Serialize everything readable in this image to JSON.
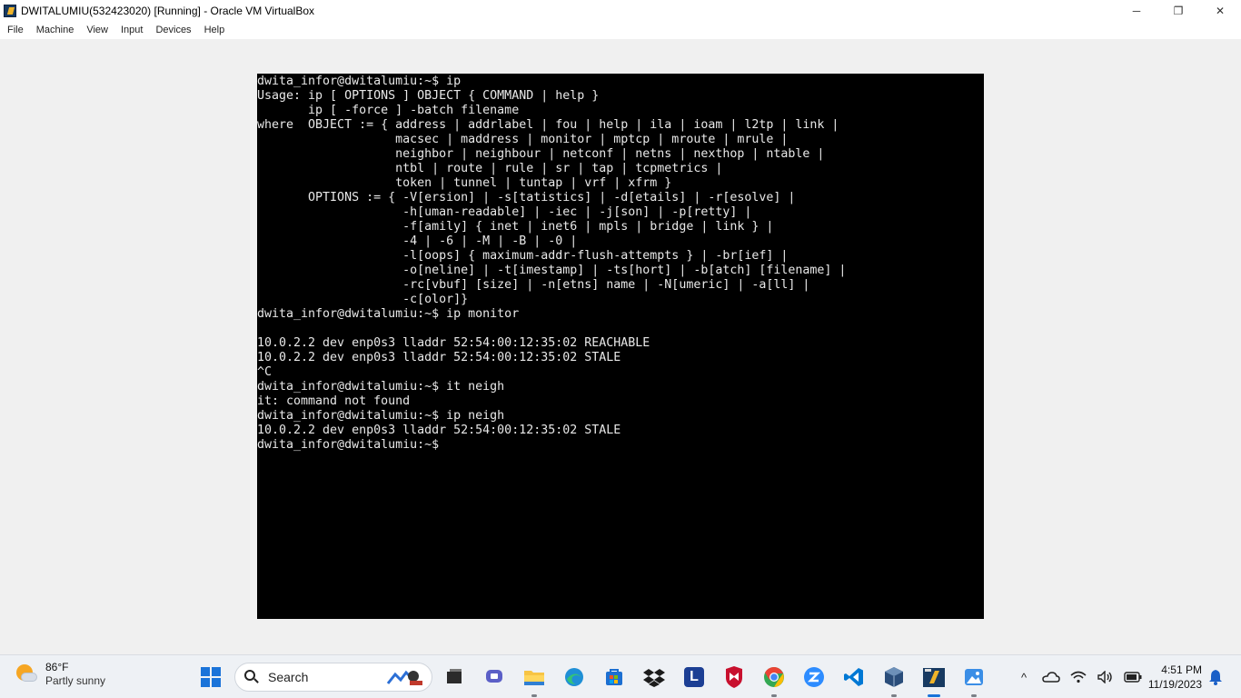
{
  "window": {
    "title": "DWITALUMIU(532423020) [Running] - Oracle VM VirtualBox",
    "icon": "virtualbox-icon",
    "controls": {
      "minimize": "─",
      "restore": "❐",
      "close": "✕"
    }
  },
  "menu": {
    "items": [
      "File",
      "Machine",
      "View",
      "Input",
      "Devices",
      "Help"
    ]
  },
  "terminal": {
    "lines": [
      "dwita_infor@dwitalumiu:~$ ip",
      "Usage: ip [ OPTIONS ] OBJECT { COMMAND | help }",
      "       ip [ -force ] -batch filename",
      "where  OBJECT := { address | addrlabel | fou | help | ila | ioam | l2tp | link |",
      "                   macsec | maddress | monitor | mptcp | mroute | mrule |",
      "                   neighbor | neighbour | netconf | netns | nexthop | ntable |",
      "                   ntbl | route | rule | sr | tap | tcpmetrics |",
      "                   token | tunnel | tuntap | vrf | xfrm }",
      "       OPTIONS := { -V[ersion] | -s[tatistics] | -d[etails] | -r[esolve] |",
      "                    -h[uman-readable] | -iec | -j[son] | -p[retty] |",
      "                    -f[amily] { inet | inet6 | mpls | bridge | link } |",
      "                    -4 | -6 | -M | -B | -0 |",
      "                    -l[oops] { maximum-addr-flush-attempts } | -br[ief] |",
      "                    -o[neline] | -t[imestamp] | -ts[hort] | -b[atch] [filename] |",
      "                    -rc[vbuf] [size] | -n[etns] name | -N[umeric] | -a[ll] |",
      "                    -c[olor]}",
      "dwita_infor@dwitalumiu:~$ ip monitor",
      "",
      "10.0.2.2 dev enp0s3 lladdr 52:54:00:12:35:02 REACHABLE",
      "10.0.2.2 dev enp0s3 lladdr 52:54:00:12:35:02 STALE",
      "^C",
      "dwita_infor@dwitalumiu:~$ it neigh",
      "it: command not found",
      "dwita_infor@dwitalumiu:~$ ip neigh",
      "10.0.2.2 dev enp0s3 lladdr 52:54:00:12:35:02 STALE",
      "dwita_infor@dwitalumiu:~$"
    ]
  },
  "taskbar": {
    "weather": {
      "temperature": "86°F",
      "condition": "Partly sunny",
      "icon": "partly-sunny-icon"
    },
    "search": {
      "label": "Search"
    },
    "apps": [
      {
        "name": "start-button",
        "icon": "windows-start-icon"
      },
      {
        "name": "task-view",
        "icon": "task-view-icon",
        "color": "#2b2b2b"
      },
      {
        "name": "teams-chat",
        "icon": "chat-icon",
        "color": "#5b5fc7"
      },
      {
        "name": "file-explorer",
        "icon": "folder-icon",
        "color": "#f7c444"
      },
      {
        "name": "edge",
        "icon": "edge-icon",
        "color": "#1f8fd6"
      },
      {
        "name": "microsoft-store",
        "icon": "store-icon",
        "color": "#1c6fd1"
      },
      {
        "name": "dropbox",
        "icon": "dropbox-icon",
        "color": "#1b1b1b"
      },
      {
        "name": "l-app",
        "icon": "l-letter-icon",
        "color": "#1c3f94",
        "letter": "L"
      },
      {
        "name": "mcafee",
        "icon": "mcafee-shield-icon",
        "color": "#c8102e"
      },
      {
        "name": "chrome",
        "icon": "chrome-icon",
        "color": "#34a853"
      },
      {
        "name": "zoom",
        "icon": "zoom-icon",
        "color": "#2d8cff"
      },
      {
        "name": "vscode",
        "icon": "vscode-icon",
        "color": "#0078d4"
      },
      {
        "name": "virtualbox-cube",
        "icon": "virtualbox-cube-icon",
        "color": "#2a4d7a"
      },
      {
        "name": "virtualbox-running",
        "icon": "virtualbox-running-icon",
        "color": "#f0b429"
      },
      {
        "name": "photos",
        "icon": "photos-icon",
        "color": "#3a8ee6"
      }
    ],
    "tray": {
      "chevron": "^",
      "icons": [
        "onedrive-icon",
        "wifi-icon",
        "volume-icon",
        "battery-icon"
      ],
      "time": "4:51 PM",
      "date": "11/19/2023",
      "notification_icon": "bell-icon"
    }
  }
}
